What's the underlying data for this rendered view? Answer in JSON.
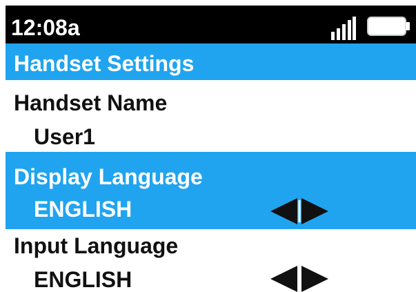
{
  "status_bar": {
    "time": "12:08a",
    "signal_icon": "signal-strength-icon",
    "battery_icon": "battery-icon"
  },
  "title_bar": {
    "title": "Handset Settings"
  },
  "settings": [
    {
      "label": "Handset Name",
      "value": "User1",
      "selected": false
    },
    {
      "label": "Display Language",
      "value": "ENGLISH",
      "selected": true,
      "adjust_icon": "left-right-arrows-icon"
    },
    {
      "label": "Input Language",
      "value": "ENGLISH",
      "selected": false,
      "adjust_icon": "left-right-arrows-icon"
    }
  ],
  "colors": {
    "status_bar": "#000000",
    "accent": "#21a4ef",
    "text": "#111111",
    "selected_text": "#ffffff"
  }
}
